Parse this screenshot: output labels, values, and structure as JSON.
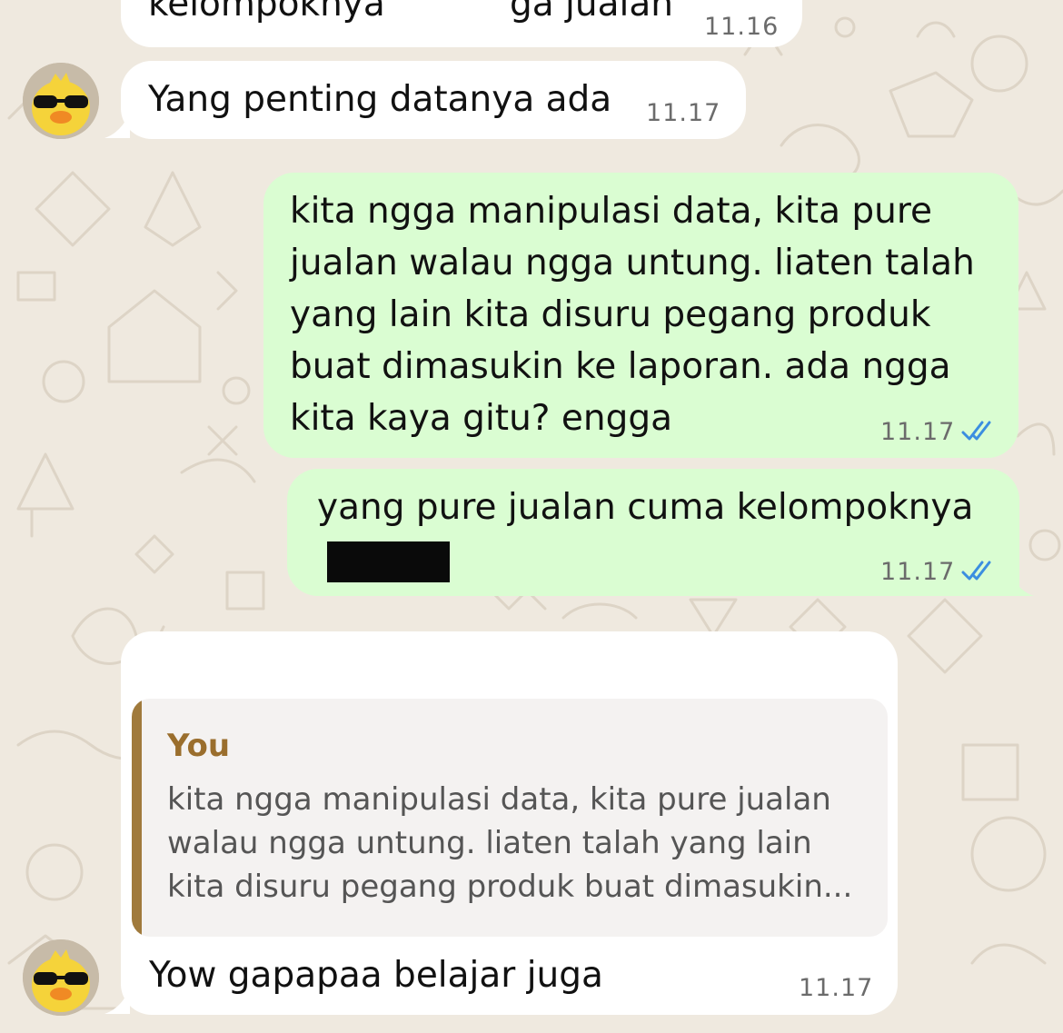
{
  "messages": [
    {
      "sender": "contact",
      "text_left": "kelompoknya",
      "text_right": "ga jualan",
      "time": "11.16"
    },
    {
      "sender": "contact",
      "text": "Yang penting datanya ada",
      "time": "11.17"
    },
    {
      "sender": "me",
      "text": "kita ngga manipulasi data, kita pure\njualan walau ngga untung. liaten talah\nyang lain kita disuru pegang produk\nbuat dimasukin ke laporan. ada ngga\nkita kaya gitu? engga",
      "time": "11.17",
      "status": "read"
    },
    {
      "sender": "me",
      "text": "yang pure jualan cuma kelompoknya",
      "time": "11.17",
      "status": "read"
    },
    {
      "sender": "contact",
      "quote": {
        "author": "You",
        "text": "kita ngga manipulasi data, kita pure jualan\nwalau ngga untung. liaten talah yang lain\nkita disuru pegang produk buat dimasukin..."
      },
      "text": "Yow gapapaa belajar juga",
      "time": "11.17"
    }
  ],
  "colors": {
    "wallpaper": "#efe9df",
    "incoming_bubble": "#ffffff",
    "outgoing_bubble": "#dafdd2",
    "read_ticks": "#3b8ee0",
    "quote_accent": "#a07a3c"
  },
  "icons": [
    "contact-avatar",
    "read-receipt-double-check-icon"
  ]
}
